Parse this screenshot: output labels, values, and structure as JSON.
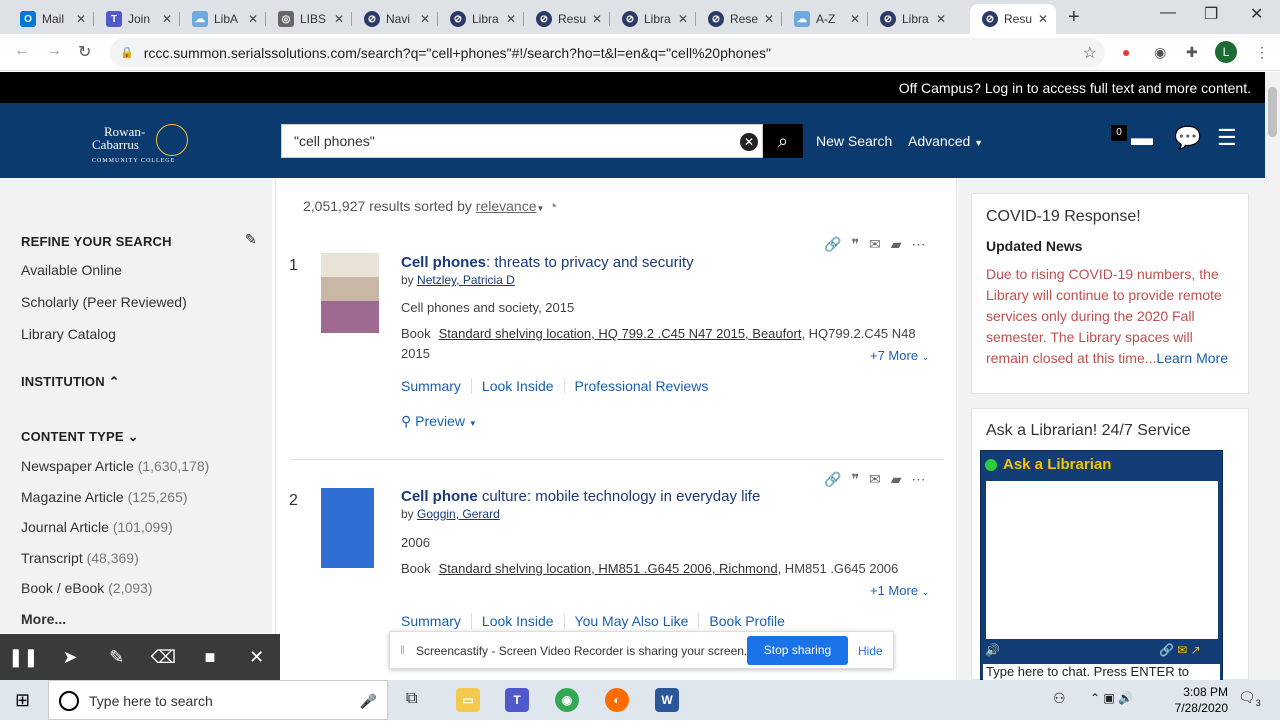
{
  "browser": {
    "tabs": [
      {
        "label": "Mail",
        "icon": "outlook-icon",
        "color": "#0078d4"
      },
      {
        "label": "Join",
        "icon": "teams-icon",
        "color": "#5059c9"
      },
      {
        "label": "LibA",
        "icon": "cloud-icon",
        "color": "#6fa8dc"
      },
      {
        "label": "LIBS",
        "icon": "globe-icon",
        "color": "#666666"
      },
      {
        "label": "Navi",
        "icon": "compass-icon",
        "color": "#2b3a67"
      },
      {
        "label": "Libra",
        "icon": "compass-icon",
        "color": "#2b3a67"
      },
      {
        "label": "Resu",
        "icon": "compass-icon",
        "color": "#2b3a67"
      },
      {
        "label": "Libra",
        "icon": "compass-icon",
        "color": "#2b3a67"
      },
      {
        "label": "Rese",
        "icon": "compass-icon",
        "color": "#2b3a67"
      },
      {
        "label": "A-Z",
        "icon": "cloud-icon",
        "color": "#6fa8dc"
      },
      {
        "label": "Libra",
        "icon": "compass-icon",
        "color": "#2b3a67"
      },
      {
        "label": "Resu",
        "icon": "compass-icon",
        "color": "#2b3a67"
      }
    ],
    "url": "rccc.summon.serialssolutions.com/search?q=\"cell+phones\"#!/search?ho=t&l=en&q=\"cell%20phones\"",
    "avatar_letter": "L"
  },
  "site": {
    "offcampus": "Off Campus? Log in to access full text and more content.",
    "logo_line1": "Rowan-",
    "logo_line2": "Cabarrus",
    "logo_line3": "COMMUNITY COLLEGE",
    "search_value": "\"cell phones\"",
    "new_search": "New Search",
    "advanced": "Advanced",
    "folder_count": "0"
  },
  "facets": {
    "refine_title": "REFINE YOUR SEARCH",
    "refine_items": [
      "Available Online",
      "Scholarly (Peer Reviewed)",
      "Library Catalog"
    ],
    "institution_title": "INSTITUTION",
    "content_type_title": "CONTENT TYPE",
    "content_types": [
      {
        "label": "Newspaper Article",
        "count": "(1,630,178)"
      },
      {
        "label": "Magazine Article",
        "count": "(125,265)"
      },
      {
        "label": "Journal Article",
        "count": "(101,099)"
      },
      {
        "label": "Transcript",
        "count": "(48,369)"
      },
      {
        "label": "Book / eBook",
        "count": "(2,093)"
      }
    ],
    "more": "More..."
  },
  "results": {
    "count_text": "2,051,927 results sorted by",
    "sort": "relevance",
    "items": [
      {
        "num": "1",
        "title_bold": "Cell phones",
        "title_rest": ": threats to privacy and security",
        "by": "by",
        "author": "Netzley, Patricia D",
        "series": "Cell phones and society, 2015",
        "type": "Book",
        "holding_link": "Standard shelving location, HQ 799.2 .C45 N47 2015, Beaufort",
        "holding_rest": ", HQ799.2.C45 N48 2015",
        "more": "+7 More",
        "links": [
          "Summary",
          "Look Inside",
          "Professional Reviews"
        ],
        "preview": "Preview"
      },
      {
        "num": "2",
        "title_bold": "Cell phone",
        "title_rest": " culture: mobile technology in everyday life",
        "by": "by",
        "author": "Goggin, Gerard",
        "series": "2006",
        "type": "Book",
        "holding_link": "Standard shelving location, HM851 .G645 2006, Richmond",
        "holding_rest": ", HM851 .G645 2006",
        "more": "+1 More",
        "links": [
          "Summary",
          "Look Inside",
          "You May Also Like",
          "Book Profile"
        ]
      }
    ]
  },
  "sidebar": {
    "covid_title": "COVID-19 Response!",
    "covid_sub": "Updated News",
    "covid_text": "Due to rising COVID-19 numbers, the Library will continue to provide remote services only during the 2020 Fall semester. The Library spaces will remain closed at this time...",
    "covid_link": "Learn More",
    "ask_title": "Ask a Librarian! 24/7 Service",
    "chat_header": "Ask a Librarian",
    "chat_input": "Type here to chat. Press ENTER to"
  },
  "screencastify": {
    "message": "Screencastify - Screen Video Recorder is sharing your screen.",
    "stop": "Stop sharing",
    "hide": "Hide"
  },
  "taskbar": {
    "search_placeholder": "Type here to search",
    "time": "3:08 PM",
    "date": "7/28/2020",
    "notif_count": "3"
  }
}
